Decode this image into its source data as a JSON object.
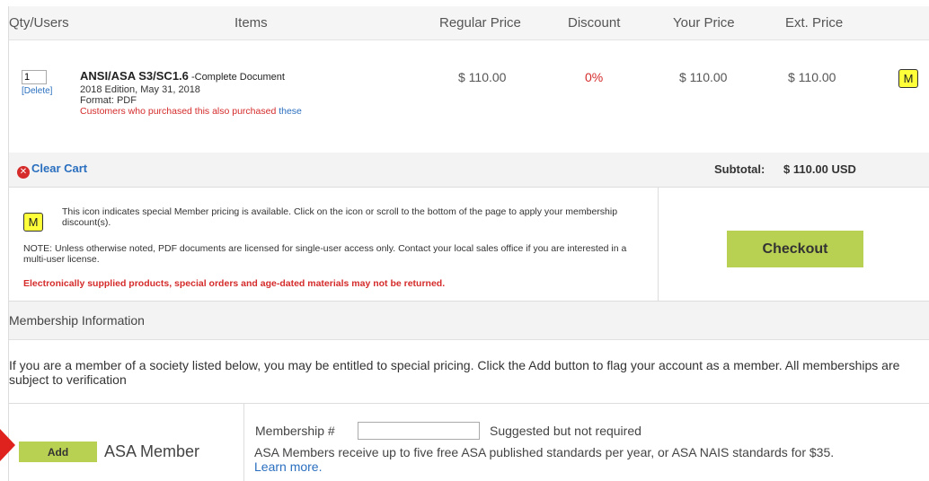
{
  "columns": {
    "qty": "Qty/Users",
    "items": "Items",
    "regular_price": "Regular Price",
    "discount": "Discount",
    "your_price": "Your Price",
    "ext_price": "Ext. Price"
  },
  "item": {
    "qty": "1",
    "delete_label": "[Delete]",
    "title": "ANSI/ASA S3/SC1.6",
    "title_suffix": " -Complete Document",
    "edition": "2018 Edition, May 31, 2018",
    "format": "Format:  PDF",
    "also_purchased": "Customers who purchased this also purchased ",
    "also_purchased_link": "these",
    "regular_price": "$  110.00",
    "discount": "0%",
    "your_price": "$  110.00",
    "ext_price": "$  110.00",
    "member_badge": "M"
  },
  "cart": {
    "clear_label": "Clear Cart",
    "subtotal_label": "Subtotal:",
    "subtotal_value": "$ 110.00 USD"
  },
  "notes": {
    "member_badge": "M",
    "member_note": "This icon indicates special Member pricing is available. Click on the icon or scroll to the bottom of the page to apply your membership discount(s).",
    "license_note": "NOTE: Unless otherwise noted, PDF documents are licensed for single-user access only. Contact your local sales office if you are interested in a multi-user license.",
    "returns_note": "Electronically supplied products, special orders and age-dated materials may not be returned."
  },
  "checkout_label": "Checkout",
  "membership": {
    "header": "Membership Information",
    "description": "If you are a member of a society listed below, you may be entitled to special pricing. Click the Add button to flag your account as a member. All memberships are subject to verification",
    "add_label": "Add",
    "society_name": "ASA Member",
    "number_label": "Membership #",
    "number_value": "",
    "number_hint": "Suggested but not required",
    "benefit_text": "ASA Members receive up to five free ASA published standards per year, or ASA NAIS standards for $35.",
    "learn_more": "Learn more."
  },
  "colors": {
    "accent_green": "#b9d152",
    "member_yellow": "#ffff3a",
    "warning_red": "#d52b2b",
    "link_blue": "#2a6fbf",
    "pointer_red": "#e0221f"
  }
}
